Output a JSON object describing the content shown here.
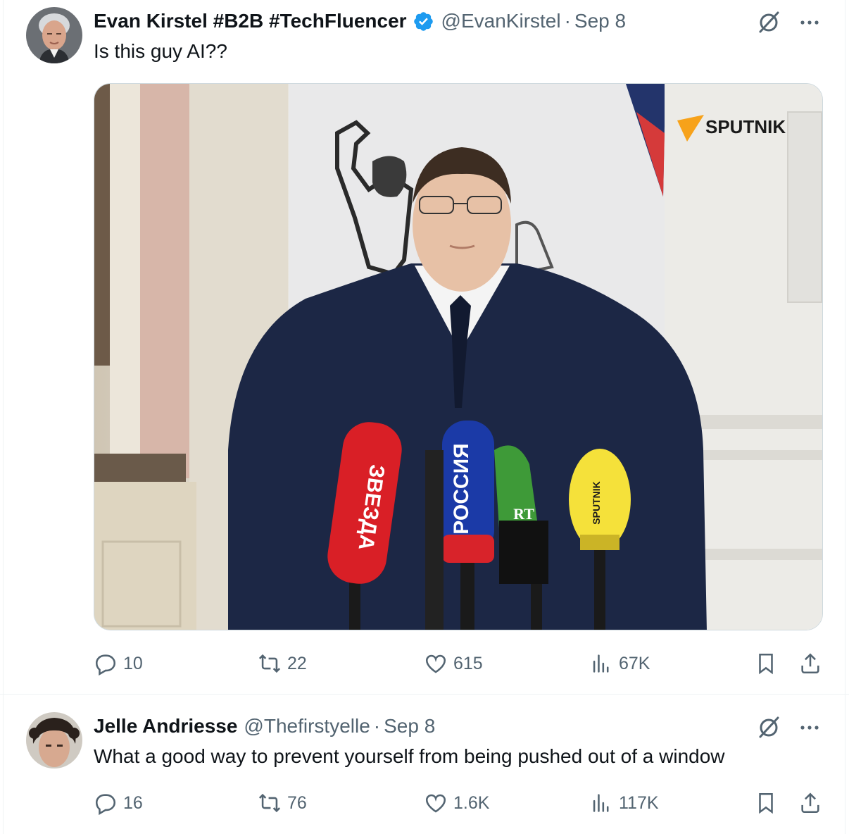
{
  "tweets": [
    {
      "author_name": "Evan Kirstel #B2B #TechFluencer",
      "verified": true,
      "handle": "@EvanKirstel",
      "separator": "·",
      "date": "Sep 8",
      "text": "Is this guy AI??",
      "media": {
        "mic_labels": [
          "ЗВЕЗДА",
          "РОССИЯ",
          "RT",
          "SPUTNIK"
        ],
        "watermark": "SPUTNIK"
      },
      "stats": {
        "replies": "10",
        "reposts": "22",
        "likes": "615",
        "views": "67K"
      }
    },
    {
      "author_name": "Jelle Andriesse",
      "verified": false,
      "handle": "@Thefirstyelle",
      "separator": "·",
      "date": "Sep 8",
      "text": "What a good way to prevent yourself from being pushed out of a window",
      "stats": {
        "replies": "16",
        "reposts": "76",
        "likes": "1.6K",
        "views": "117K"
      }
    }
  ],
  "icons": {
    "verified": "verified-badge-icon",
    "grok": "grok-icon",
    "more": "more-icon",
    "reply": "reply-icon",
    "repost": "repost-icon",
    "like": "heart-icon",
    "views": "views-icon",
    "bookmark": "bookmark-icon",
    "share": "share-icon"
  },
  "colors": {
    "text": "#0f1419",
    "secondary": "#536471",
    "verified": "#1d9bf0",
    "border": "#eff3f4"
  }
}
